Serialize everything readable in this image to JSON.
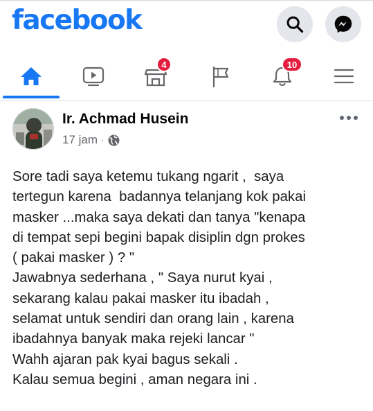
{
  "header": {
    "logo_text": "facebook",
    "brand_color": "#1877f2",
    "actions": [
      {
        "name": "search",
        "icon": "search-icon"
      },
      {
        "name": "messenger",
        "icon": "messenger-icon"
      }
    ]
  },
  "nav": {
    "active_tab": "home",
    "tabs": [
      {
        "name": "home",
        "icon": "home-icon"
      },
      {
        "name": "watch",
        "icon": "video-icon"
      },
      {
        "name": "marketplace",
        "icon": "marketplace-icon",
        "badge": "4"
      },
      {
        "name": "pages",
        "icon": "flag-icon"
      },
      {
        "name": "notifications",
        "icon": "bell-icon",
        "badge": "10"
      },
      {
        "name": "menu",
        "icon": "hamburger-icon"
      }
    ],
    "badge_color": "#e41e3f"
  },
  "post": {
    "author": "Ir. Achmad Husein",
    "time": "17 jam",
    "separator": "·",
    "audience_icon": "globe-icon",
    "lines": [
      "Sore tadi saya ketemu tukang ngarit ,  saya",
      "tertegun karena  badannya telanjang kok pakai",
      "masker ...maka saya dekati dan tanya \"kenapa",
      "di tempat sepi begini bapak disiplin dgn prokes",
      "( pakai masker ) ? \"",
      "Jawabnya sederhana , \" Saya nurut kyai ,",
      "sekarang kalau pakai masker itu ibadah ,",
      "selamat untuk sendiri dan orang lain , karena",
      "ibadahnya banyak maka rejeki lancar \"",
      "Wahh ajaran pak kyai bagus sekali .",
      "Kalau semua begini , aman negara ini ."
    ]
  }
}
